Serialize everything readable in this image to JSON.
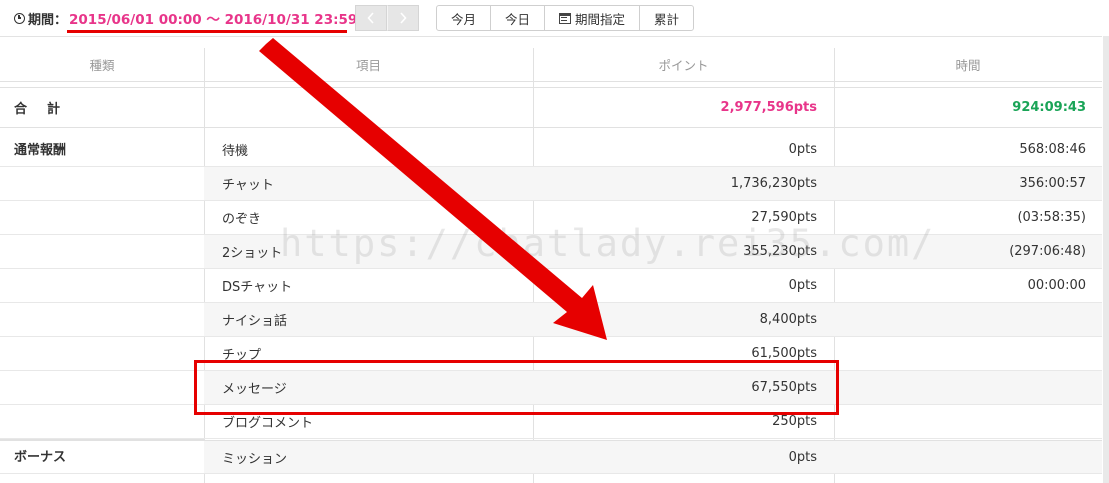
{
  "toolbar": {
    "period_label": "期間：",
    "period_range": "2015/06/01 00:00 ～ 2016/10/31 23:59",
    "prev_icon": "chevron-left-icon",
    "next_icon": "chevron-right-icon",
    "buttons": [
      "今月",
      "今日",
      "期間指定",
      "累計"
    ]
  },
  "table": {
    "headers": [
      "種類",
      "項目",
      "ポイント",
      "時間"
    ],
    "total": {
      "label": "合計",
      "points": "2,977,596pts",
      "time": "924:09:43"
    },
    "groups": [
      {
        "label": "通常報酬"
      },
      {
        "label": "ボーナス"
      }
    ],
    "rows": [
      {
        "item": "待機",
        "points": "0pts",
        "time": "568:08:46"
      },
      {
        "item": "チャット",
        "points": "1,736,230pts",
        "time": "356:00:57"
      },
      {
        "item": "のぞき",
        "points": "27,590pts",
        "time": "(03:58:35)"
      },
      {
        "item": "2ショット",
        "points": "355,230pts",
        "time": "(297:06:48)"
      },
      {
        "item": "DSチャット",
        "points": "0pts",
        "time": "00:00:00"
      },
      {
        "item": "ナイショ話",
        "points": "8,400pts",
        "time": ""
      },
      {
        "item": "チップ",
        "points": "61,500pts",
        "time": ""
      },
      {
        "item": "メッセージ",
        "points": "67,550pts",
        "time": ""
      },
      {
        "item": "ブログコメント",
        "points": "250pts",
        "time": ""
      },
      {
        "item": "ミッション",
        "points": "0pts",
        "time": ""
      }
    ]
  },
  "watermark": "https://chatlady.rei35.com/",
  "colors": {
    "accent_pink": "#e8358a",
    "accent_green": "#1aa457",
    "annotation_red": "#e60000"
  }
}
